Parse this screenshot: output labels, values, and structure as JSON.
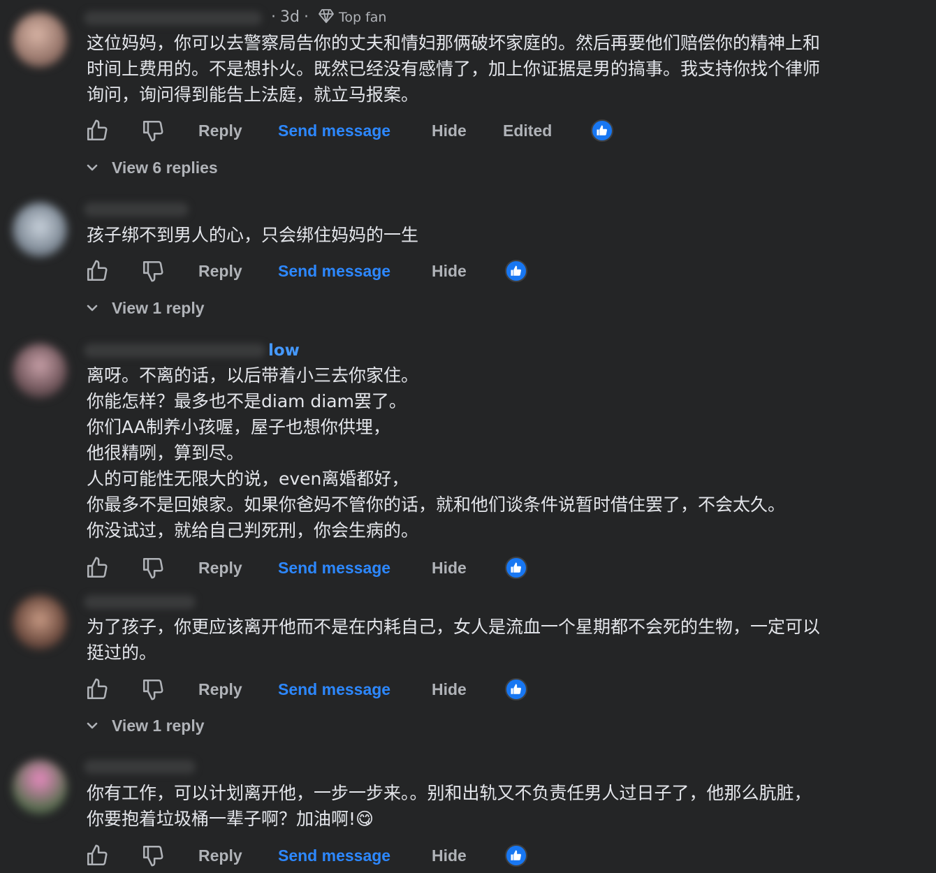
{
  "comments": [
    {
      "meta": {
        "time": "3d",
        "badge": "Top fan"
      },
      "lines": [
        "这位妈妈，你可以去警察局告你的丈夫和情妇那俩破坏家庭的。然后再要他们赔偿你的精神上和",
        "时间上费用的。不是想扑火。既然已经没有感情了，加上你证据是男的搞事。我支持你找个律师",
        "询问，询问得到能告上法庭，就立马报案。"
      ],
      "actions": {
        "reply": "Reply",
        "send_message": "Send message",
        "hide": "Hide",
        "edited": "Edited"
      },
      "replies_label": "View 6 replies"
    },
    {
      "lines": [
        "孩子绑不到男人的心，只会绑住妈妈的一生"
      ],
      "actions": {
        "reply": "Reply",
        "send_message": "Send message",
        "hide": "Hide"
      },
      "replies_label": "View 1 reply"
    },
    {
      "meta": {
        "follow": "low"
      },
      "lines": [
        "离呀。不离的话，以后带着小三去你家住。",
        "你能怎样？最多也不是diam diam罢了。",
        "你们AA制养小孩喔，屋子也想你供埋，",
        "他很精咧，算到尽。",
        "人的可能性无限大的说，even离婚都好，",
        "你最多不是回娘家。如果你爸妈不管你的话，就和他们谈条件说暂时借住罢了，不会太久。",
        "你没试过，就给自己判死刑，你会生病的。"
      ],
      "actions": {
        "reply": "Reply",
        "send_message": "Send message",
        "hide": "Hide"
      }
    },
    {
      "lines": [
        "为了孩子，你更应该离开他而不是在内耗自己，女人是流血一个星期都不会死的生物，一定可以",
        "挺过的。"
      ],
      "actions": {
        "reply": "Reply",
        "send_message": "Send message",
        "hide": "Hide"
      },
      "replies_label": "View 1 reply"
    },
    {
      "lines": [
        "你有工作，可以计划离开他，一步一步来。。别和出轨又不负责任男人过日子了，他那么肮脏，",
        "你要抱着垃圾桶一辈子啊？加油啊!😋"
      ],
      "actions": {
        "reply": "Reply",
        "send_message": "Send message",
        "hide": "Hide"
      }
    }
  ],
  "colors": {
    "background": "#242526",
    "text": "#e4e6eb",
    "secondary": "#b0b3b8",
    "link_blue": "#2d88ff",
    "like_blue": "#1877f2"
  },
  "icons": [
    "thumbs-up-icon",
    "thumbs-down-icon",
    "like-reaction-icon",
    "chevron-down-icon",
    "diamond-icon"
  ]
}
